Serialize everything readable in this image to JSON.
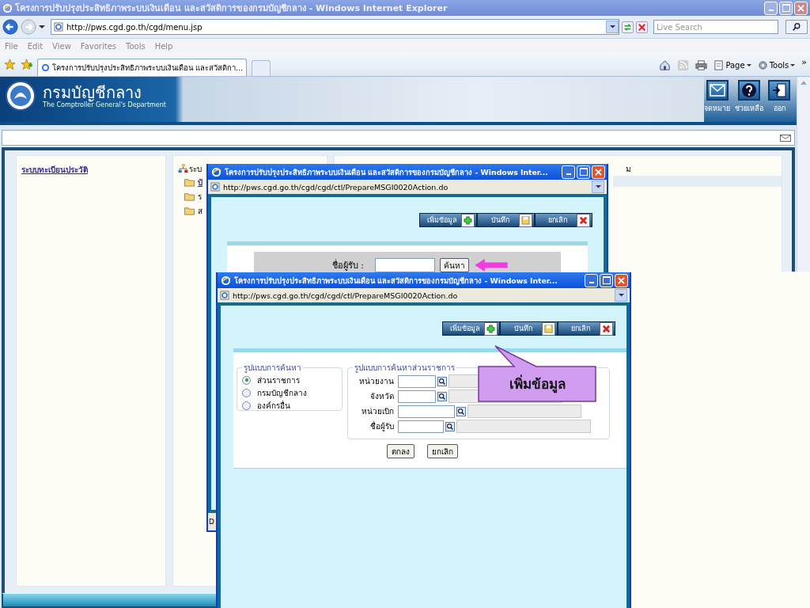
{
  "browser": {
    "title": "โครงการปรับปรุงประสิทธิภาพระบบเงินเดือน และสวัสดิการของกรมบัญชีกลาง - Windows Internet Explorer",
    "url": "http://pws.cgd.go.th/cgd/menu.jsp",
    "search_placeholder": "Live Search",
    "menu": [
      "File",
      "Edit",
      "View",
      "Favorites",
      "Tools",
      "Help"
    ],
    "tabs": [
      {
        "label": "โครงการปรับปรุงประสิทธิภาพระบบเงินเดือน และสวัสดิกา...",
        "selected": true
      }
    ],
    "toolbar": [
      {
        "label": "Page",
        "kind": "page"
      },
      {
        "label": "Tools",
        "kind": "tools"
      }
    ],
    "more": "»"
  },
  "page": {
    "header": {
      "title": "กรมบัญชีกลาง",
      "subtitle": "The Comptroller General's Department",
      "actions": [
        {
          "label": "จดหมาย",
          "kind": "mail"
        },
        {
          "label": "ช่วยเหลือ",
          "kind": "help"
        },
        {
          "label": "ออก",
          "kind": "exit"
        }
      ]
    },
    "left_link": "ระบบทะเบียนประวัติ",
    "tree": {
      "root": "ระบ",
      "children": [
        {
          "label": "บั",
          "link": true
        },
        {
          "label": "ร",
          "link": false
        },
        {
          "label": "ส",
          "link": false
        }
      ]
    },
    "right_text": "ม"
  },
  "popups": [
    {
      "title": "โครงการปรับปรุงประสิทธิภาพระบบเงินเดือน และสวัสดิการของกรมบัญชีกลาง - Windows Inter...",
      "url": "http://pws.cgd.go.th/cgd/cgd/ctl/PrepareMSGI0020Action.do",
      "buttons": [
        {
          "label": "เพิ่มข้อมูล",
          "kind": "add"
        },
        {
          "label": "บันทึก",
          "kind": "save"
        },
        {
          "label": "ยกเลิก",
          "kind": "cancel"
        }
      ],
      "search": {
        "label": "ชื่อผู้รับ :",
        "button": "ค้นหา"
      },
      "status": "D"
    },
    {
      "title": "โครงการปรับปรุงประสิทธิภาพระบบเงินเดือน และสวัสดิการของกรมบัญชีกลาง - Windows Inter...",
      "url": "http://pws.cgd.go.th/cgd/cgd/ctl/PrepareMSGI0020Action.do",
      "buttons": [
        {
          "label": "เพิ่มข้อมูล",
          "kind": "add"
        },
        {
          "label": "บันทึก",
          "kind": "save"
        },
        {
          "label": "ยกเลิก",
          "kind": "cancel"
        }
      ],
      "callout": "เพิ่มข้อมูล",
      "search_mode": {
        "legend": "รูปแบบการค้นหา",
        "options": [
          {
            "label": "ส่วนราชการ",
            "selected": true
          },
          {
            "label": "กรมบัญชีกลาง",
            "selected": false
          },
          {
            "label": "องค์กรอื่น",
            "selected": false
          }
        ]
      },
      "agency_search": {
        "legend": "รูปแบบการค้นหาส่วนราชการ",
        "rows": [
          {
            "label": "หน่วยงาน"
          },
          {
            "label": "จังหวัด"
          },
          {
            "label": "หน่วยเบิก"
          },
          {
            "label": "ชื่อผู้รับ"
          }
        ]
      },
      "actions": [
        "ตกลง",
        "ยกเลิก"
      ]
    }
  ]
}
